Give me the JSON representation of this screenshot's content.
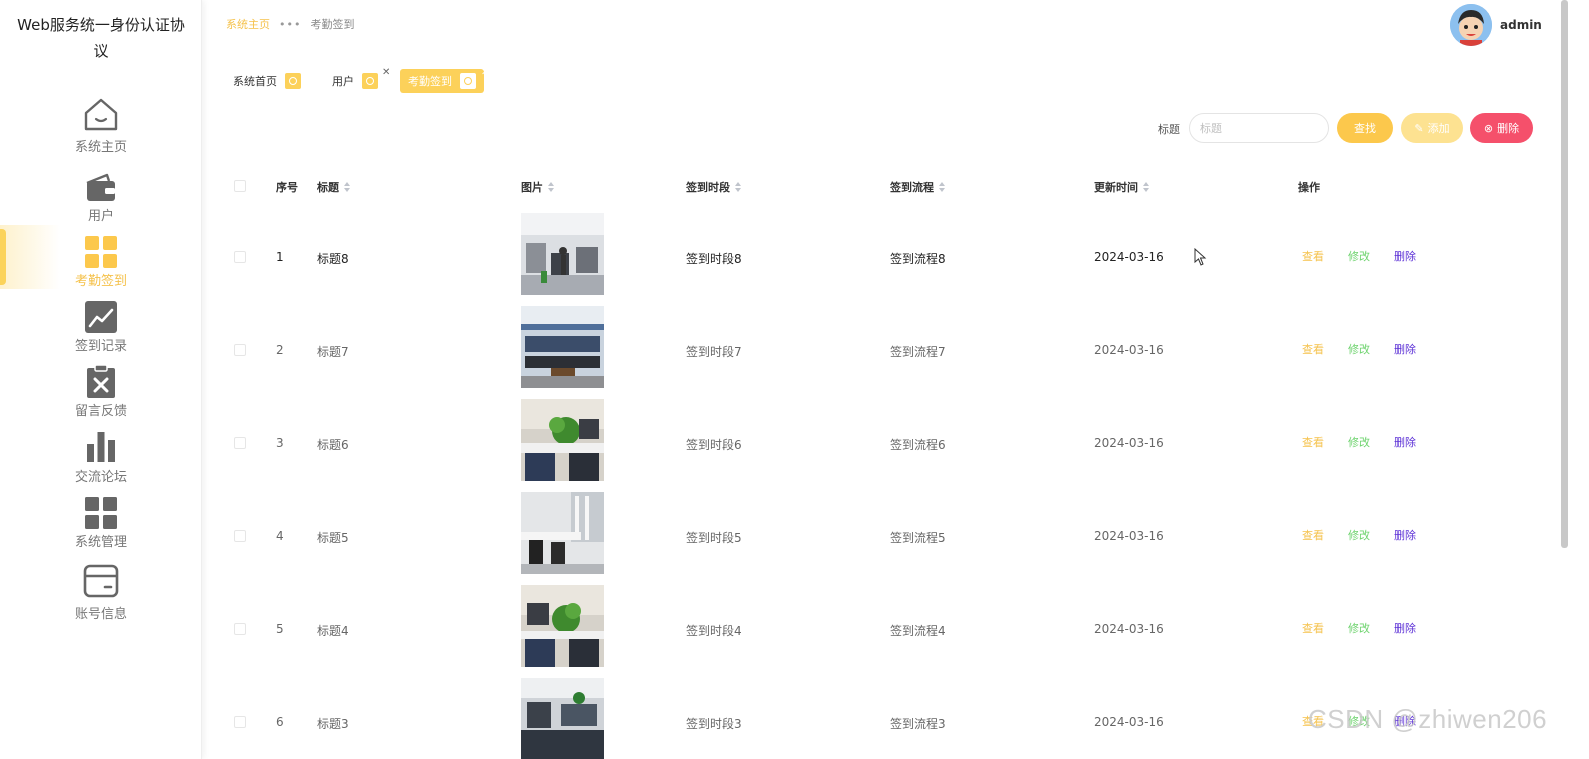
{
  "brand": {
    "title": "Web服务统一身份认证协议"
  },
  "sidebar": {
    "items": [
      {
        "label": "系统主页",
        "icon": "home-icon",
        "active": false
      },
      {
        "label": "用户",
        "icon": "wallet-icon",
        "active": false
      },
      {
        "label": "考勤签到",
        "icon": "grid-icon",
        "active": true
      },
      {
        "label": "签到记录",
        "icon": "trend-chart-icon",
        "active": false
      },
      {
        "label": "留言反馈",
        "icon": "clipboard-x-icon",
        "active": false
      },
      {
        "label": "交流论坛",
        "icon": "bar-chart-icon",
        "active": false
      },
      {
        "label": "系统管理",
        "icon": "apps-icon",
        "active": false
      },
      {
        "label": "账号信息",
        "icon": "card-icon",
        "active": false
      }
    ]
  },
  "header": {
    "breadcrumb": {
      "home": "系统主页",
      "separator": "•••",
      "current": "考勤签到"
    },
    "user": {
      "name": "admin"
    }
  },
  "tags": [
    {
      "label": "系统首页",
      "closable": false,
      "active": false
    },
    {
      "label": "用户",
      "closable": true,
      "active": false
    },
    {
      "label": "考勤签到",
      "closable": true,
      "active": true
    }
  ],
  "toolbar": {
    "search_label": "标题",
    "search_placeholder": "标题",
    "search_value": "",
    "find_label": "查找",
    "add_label": "添加",
    "delete_label": "删除"
  },
  "table": {
    "columns": {
      "index": "序号",
      "title": "标题",
      "image": "图片",
      "period": "签到时段",
      "flow": "签到流程",
      "updated": "更新时间",
      "actions": "操作"
    },
    "action_labels": {
      "view": "查看",
      "edit": "修改",
      "delete": "删除"
    },
    "rows": [
      {
        "index": "1",
        "title": "标题8",
        "period": "签到时段8",
        "flow": "签到流程8",
        "updated": "2024-03-16"
      },
      {
        "index": "2",
        "title": "标题7",
        "period": "签到时段7",
        "flow": "签到流程7",
        "updated": "2024-03-16"
      },
      {
        "index": "3",
        "title": "标题6",
        "period": "签到时段6",
        "flow": "签到流程6",
        "updated": "2024-03-16"
      },
      {
        "index": "4",
        "title": "标题5",
        "period": "签到时段5",
        "flow": "签到流程5",
        "updated": "2024-03-16"
      },
      {
        "index": "5",
        "title": "标题4",
        "period": "签到时段4",
        "flow": "签到流程4",
        "updated": "2024-03-16"
      },
      {
        "index": "6",
        "title": "标题3",
        "period": "签到时段3",
        "flow": "签到流程3",
        "updated": "2024-03-16"
      }
    ]
  },
  "colors": {
    "accent": "#fcc84c",
    "accent_light": "#fde291",
    "danger": "#f5506b",
    "edit_green": "#6dd36d",
    "delete_purple": "#5b2fd6"
  },
  "watermark": "CSDN @zhiwen206"
}
